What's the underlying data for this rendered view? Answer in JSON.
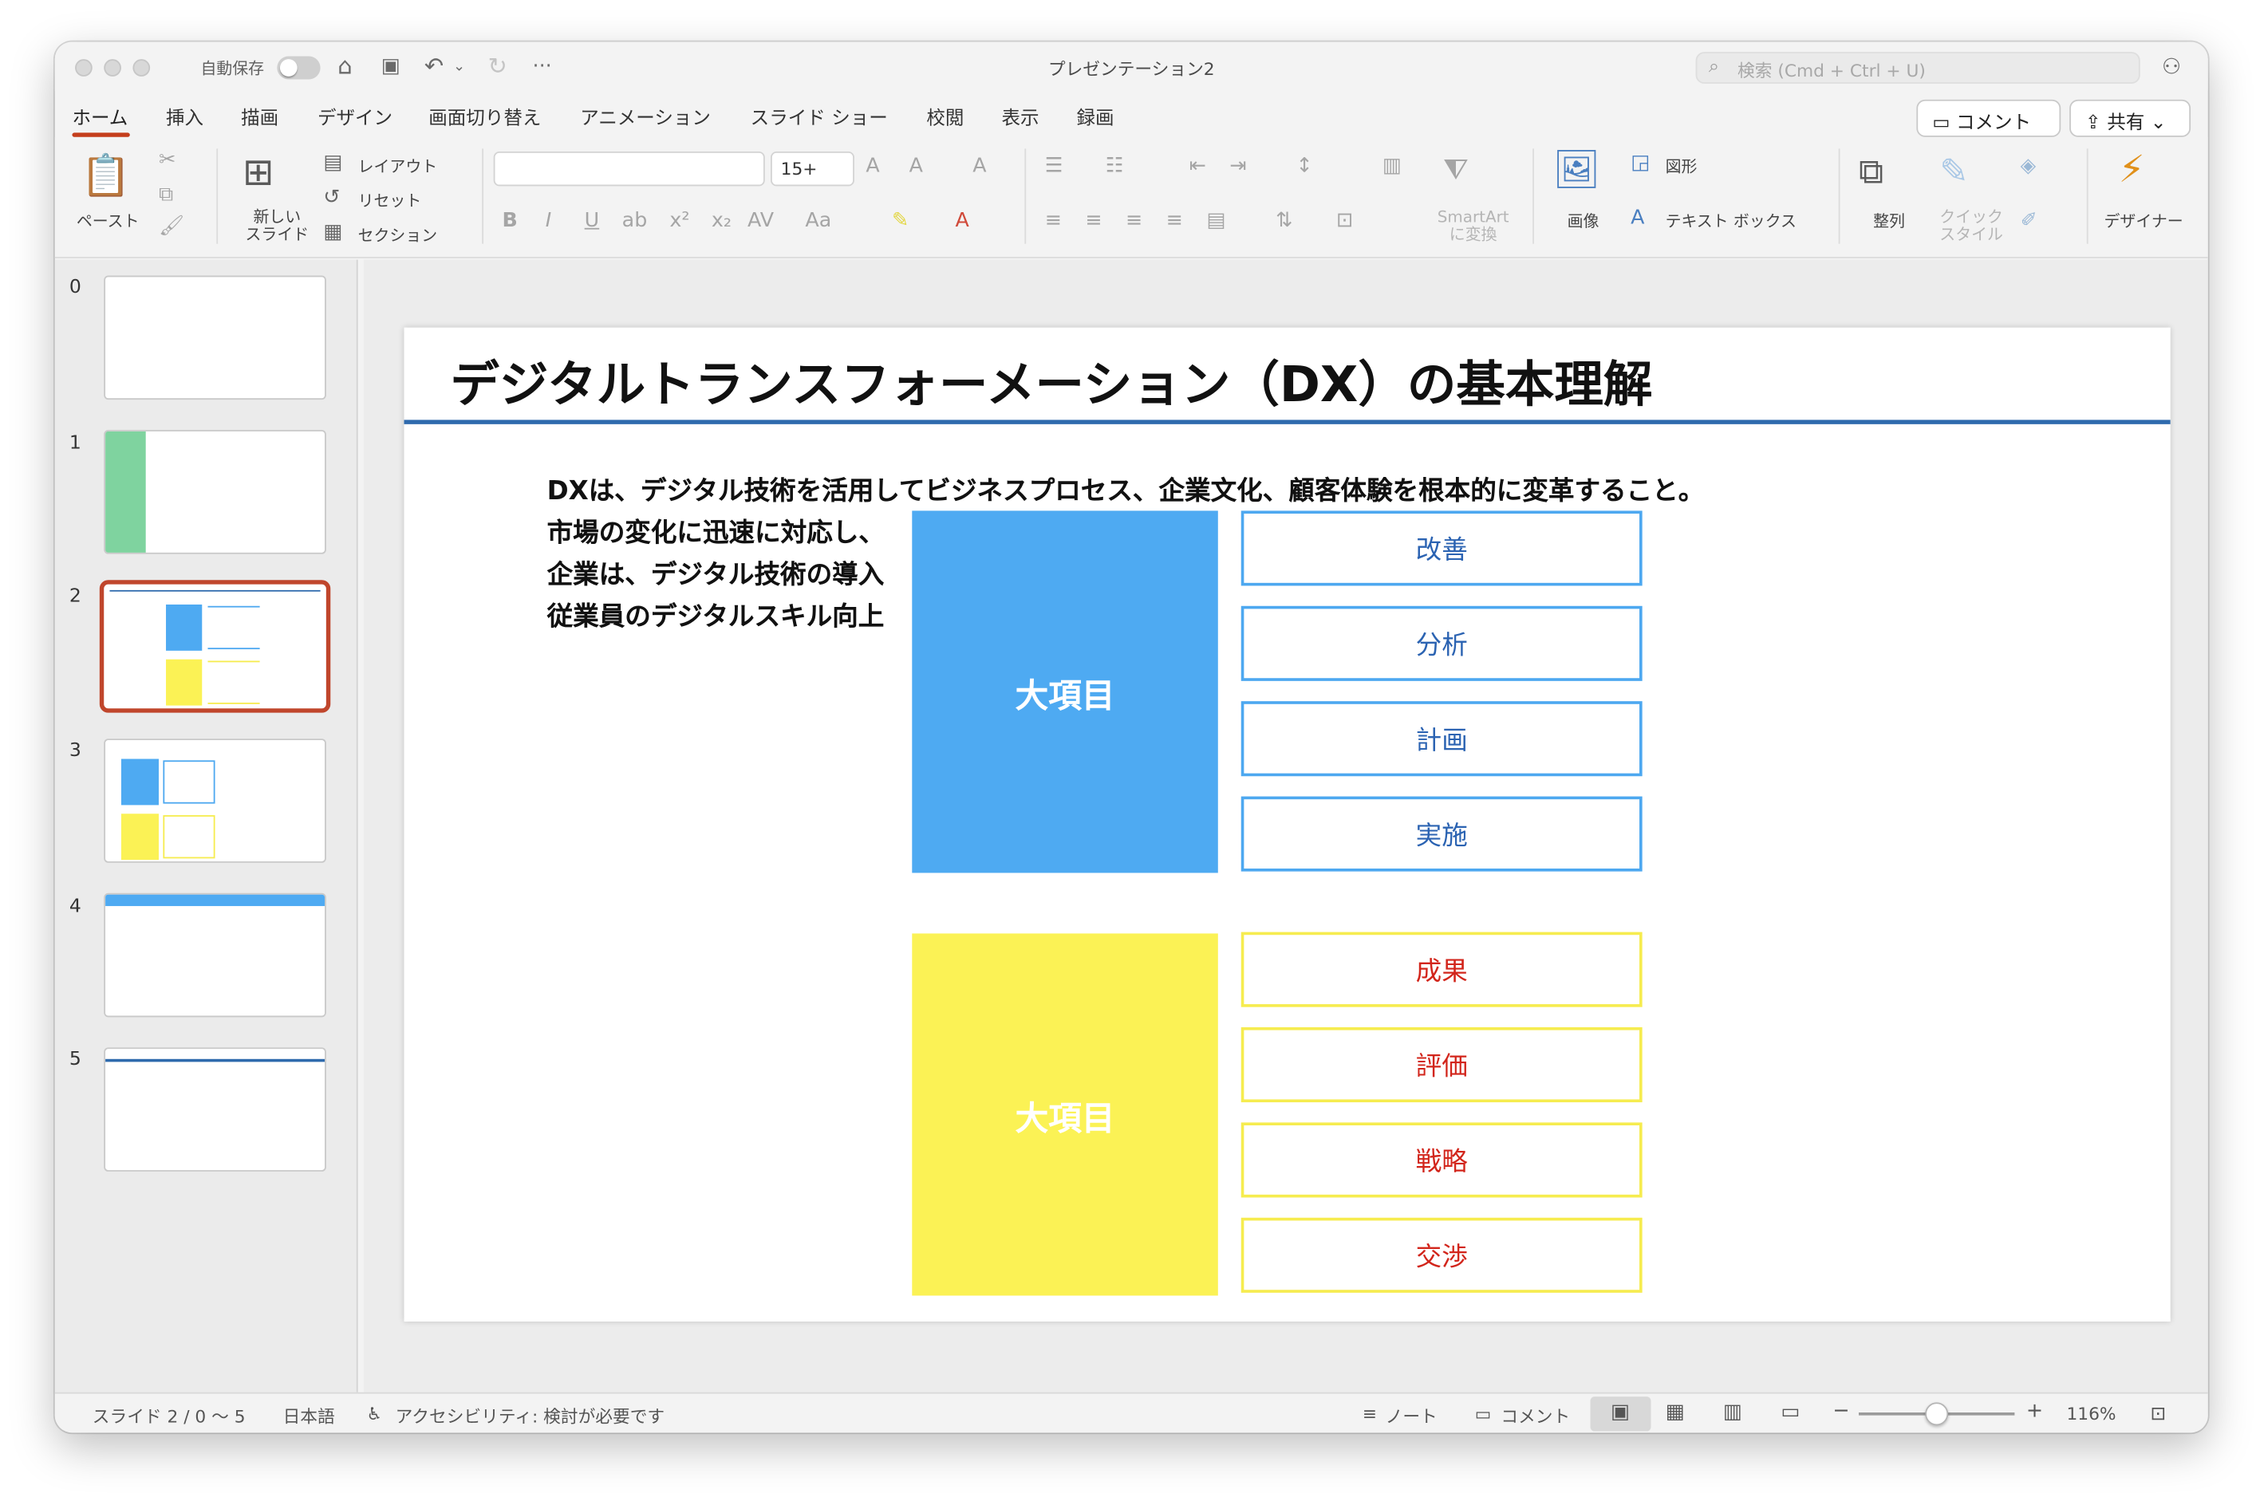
{
  "window": {
    "autosave_label": "自動保存",
    "doc_title": "プレゼンテーション2",
    "search_placeholder": "検索 (Cmd + Ctrl + U)",
    "icons": [
      "home-icon",
      "save-icon",
      "undo-icon",
      "redo-icon",
      "more-icon",
      "share-people-icon"
    ]
  },
  "tabs": [
    "ホーム",
    "挿入",
    "描画",
    "デザイン",
    "画面切り替え",
    "アニメーション",
    "スライド ショー",
    "校閲",
    "表示",
    "録画"
  ],
  "header_buttons": {
    "comment": "コメント",
    "share": "共有"
  },
  "ribbon": {
    "paste": "ペースト",
    "new_slide": "新しい\nスライド",
    "layout": "レイアウト",
    "reset": "リセット",
    "section": "セクション",
    "font_name": "",
    "font_size": "15+",
    "smartart": "SmartArt\nに変換",
    "picture": "画像",
    "shapes": "図形",
    "textbox": "テキスト ボックス",
    "arrange": "整列",
    "quick_styles": "クイック\nスタイル",
    "designer": "デザイナー"
  },
  "thumbnails": [
    {
      "number": "0"
    },
    {
      "number": "1"
    },
    {
      "number": "2",
      "selected": true
    },
    {
      "number": "3"
    },
    {
      "number": "4"
    },
    {
      "number": "5"
    }
  ],
  "slide": {
    "title": "デジタルトランスフォーメーション（DX）の基本理解",
    "body_lines": [
      "DXは、デジタル技術を活用してビジネスプロセス、企業文化、顧客体験を根本的に変革すること。",
      "市場の変化に迅速に対応し、",
      "企業は、デジタル技術の導入",
      "従業員のデジタルスキル向上"
    ],
    "blue_group": {
      "label": "大項目",
      "color": "#4eaaf2",
      "items": [
        "改善",
        "分析",
        "計画",
        "実施"
      ]
    },
    "yellow_group": {
      "label": "大項目",
      "color": "#fbf255",
      "items": [
        "成果",
        "評価",
        "戦略",
        "交渉"
      ]
    }
  },
  "status": {
    "slide_info": "スライド 2 / 0 〜 5",
    "language": "日本語",
    "accessibility": "アクセシビリティ: 検討が必要です",
    "notes": "ノート",
    "comments": "コメント",
    "zoom": "116%"
  }
}
